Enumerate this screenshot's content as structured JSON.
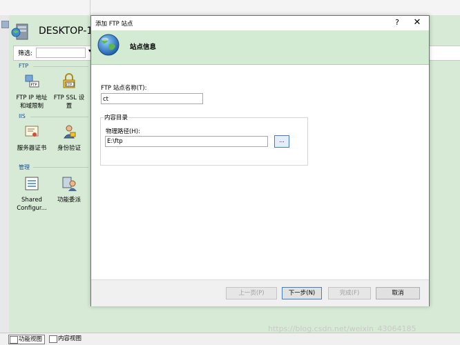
{
  "window": {
    "server_title": "DESKTOP-1",
    "filter_label": "筛选:",
    "filter_value": "",
    "filter_arrow": "▾"
  },
  "groups": {
    "ftp": "FTP",
    "iis": "IIS",
    "manage": "管理"
  },
  "features": {
    "ftp_ip": [
      "FTP IP 地址",
      "和域限制"
    ],
    "ftp_ssl": [
      "FTP SSL 设",
      "置"
    ],
    "server_cert": "服务器证书",
    "auth": "身份验证",
    "shared_config": [
      "Shared",
      "Configur..."
    ],
    "delegation": "功能委派"
  },
  "bottom_bar": {
    "feature_view": "功能视图",
    "content_view": "内容视图"
  },
  "watermark": "https://blog.csdn.net/weixin_43064185",
  "dialog": {
    "title": "添加 FTP 站点",
    "help_label": "?",
    "close_label": "✕",
    "header_title": "站点信息",
    "site_name_label": "FTP 站点名称(T):",
    "site_name_value": "ct",
    "content_dir_label": "内容目录",
    "physical_path_label": "物理路径(H):",
    "physical_path_value": "E:\\ftp",
    "browse_label": "...",
    "buttons": {
      "prev": "上一页(P)",
      "next": "下一步(N)",
      "finish": "完成(F)",
      "cancel": "取消"
    }
  },
  "colors": {
    "header_band": "#d3ead3",
    "background_pane": "#d6ead6",
    "accent_blue": "#3c7fc6"
  },
  "icons": [
    "server-icon",
    "globe-icon",
    "ftp-ip-icon",
    "ftp-ssl-lock-icon",
    "certificate-icon",
    "user-auth-icon",
    "shared-config-icon",
    "delegation-icon"
  ]
}
